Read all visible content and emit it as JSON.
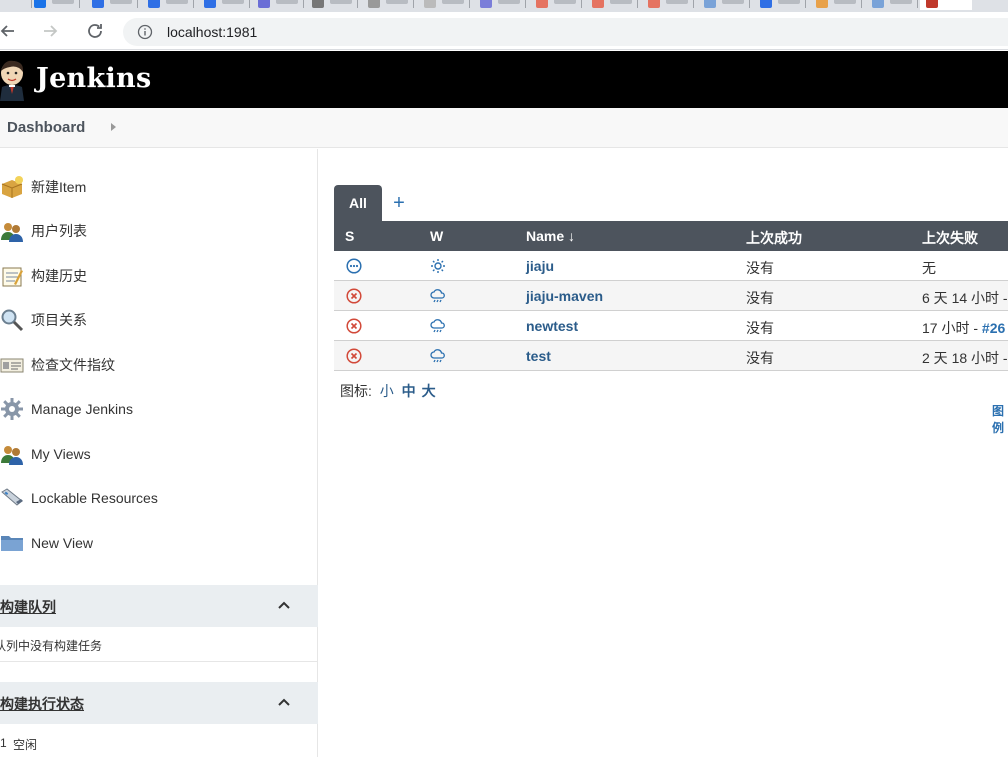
{
  "browser": {
    "url": "localhost:1981"
  },
  "header": {
    "title": "Jenkins"
  },
  "breadcrumb": {
    "label": "Dashboard"
  },
  "sidebar": {
    "tasks": [
      {
        "label": "新建Item",
        "icon": "new-package-icon"
      },
      {
        "label": "用户列表",
        "icon": "users-icon"
      },
      {
        "label": "构建历史",
        "icon": "notepad-icon"
      },
      {
        "label": "项目关系",
        "icon": "magnifier-icon"
      },
      {
        "label": "检查文件指纹",
        "icon": "fingerprint-icon"
      },
      {
        "label": "Manage Jenkins",
        "icon": "gear-icon"
      },
      {
        "label": "My Views",
        "icon": "users-icon"
      },
      {
        "label": "Lockable Resources",
        "icon": "usb-icon"
      },
      {
        "label": "New View",
        "icon": "folder-icon"
      }
    ],
    "queue": {
      "title": "构建队列",
      "empty_text": "队列中没有构建任务"
    },
    "executors": {
      "title": "构建执行状态",
      "row_num": "1",
      "row_state": "空闲"
    }
  },
  "main": {
    "tabs": [
      {
        "label": "All"
      },
      {
        "label": "+"
      }
    ],
    "columns": {
      "s": "S",
      "w": "W",
      "name": "Name ↓",
      "last_success": "上次成功",
      "last_failure": "上次失败"
    },
    "jobs": [
      {
        "name": "jiaju",
        "status": "not-built",
        "weather": "sunny",
        "last_success": "没有",
        "last_failure": "无",
        "build": ""
      },
      {
        "name": "jiaju-maven",
        "status": "failed",
        "weather": "storm",
        "last_success": "没有",
        "last_failure": "6 天 14 小时 -",
        "build": ""
      },
      {
        "name": "newtest",
        "status": "failed",
        "weather": "storm",
        "last_success": "没有",
        "last_failure": "17 小时 - ",
        "build": "#26"
      },
      {
        "name": "test",
        "status": "failed",
        "weather": "storm",
        "last_success": "没有",
        "last_failure": "2 天 18 小时 -",
        "build": ""
      }
    ],
    "legend": {
      "label": "图标:",
      "small": "小",
      "medium": "中",
      "large": "大"
    },
    "legend_link": "图例"
  },
  "colors": {
    "header_bg": "#000000",
    "table_header_bg": "#4d545d",
    "link": "#2b5c8a",
    "failed": "#d24939",
    "not_built": "#2b70b0"
  }
}
